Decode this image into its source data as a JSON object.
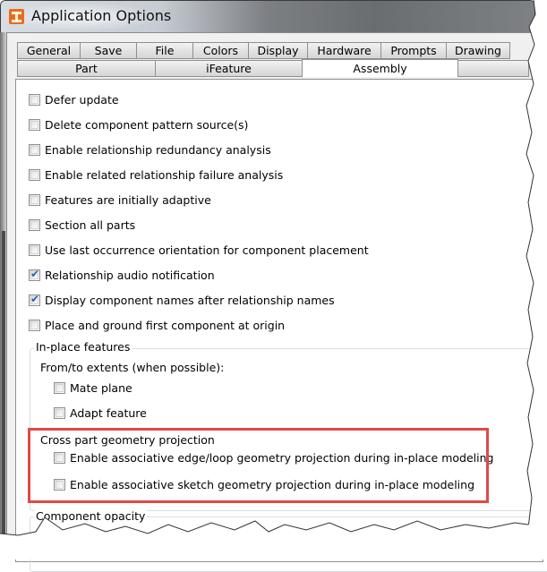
{
  "window": {
    "title": "Application Options",
    "icon": "autodesk-inventor-icon"
  },
  "tabs": {
    "row1": [
      {
        "label": "General"
      },
      {
        "label": "Save"
      },
      {
        "label": "File"
      },
      {
        "label": "Colors"
      },
      {
        "label": "Display"
      },
      {
        "label": "Hardware"
      },
      {
        "label": "Prompts"
      },
      {
        "label": "Drawing"
      }
    ],
    "row2": [
      {
        "label": "Part"
      },
      {
        "label": "iFeature"
      },
      {
        "label": "Assembly",
        "active": true
      }
    ]
  },
  "options": [
    {
      "label": "Defer update",
      "checked": false
    },
    {
      "label": "Delete component pattern source(s)",
      "checked": false
    },
    {
      "label": "Enable relationship redundancy analysis",
      "checked": false
    },
    {
      "label": "Enable related relationship failure analysis",
      "checked": false
    },
    {
      "label": "Features are initially adaptive",
      "checked": false
    },
    {
      "label": "Section all parts",
      "checked": false
    },
    {
      "label": "Use last occurrence orientation for component placement",
      "checked": false
    },
    {
      "label": "Relationship audio notification",
      "checked": true
    },
    {
      "label": "Display component names after relationship names",
      "checked": true
    },
    {
      "label": "Place and ground first component at origin",
      "checked": false
    }
  ],
  "in_place_features": {
    "title": "In-place features",
    "extents_label": "From/to extents (when possible):",
    "options": [
      {
        "label": "Mate plane",
        "checked": false
      },
      {
        "label": "Adapt feature",
        "checked": false
      }
    ]
  },
  "cross_part_projection": {
    "title": "Cross part geometry projection",
    "options": [
      {
        "label": "Enable associative edge/loop geometry projection during in-place modeling",
        "checked": false
      },
      {
        "label": "Enable associative sketch geometry projection during in-place modeling",
        "checked": false
      }
    ],
    "highlight_color": "#e04a46"
  },
  "component_opacity": {
    "title": "Component opacity"
  },
  "check_glyph": "✔"
}
